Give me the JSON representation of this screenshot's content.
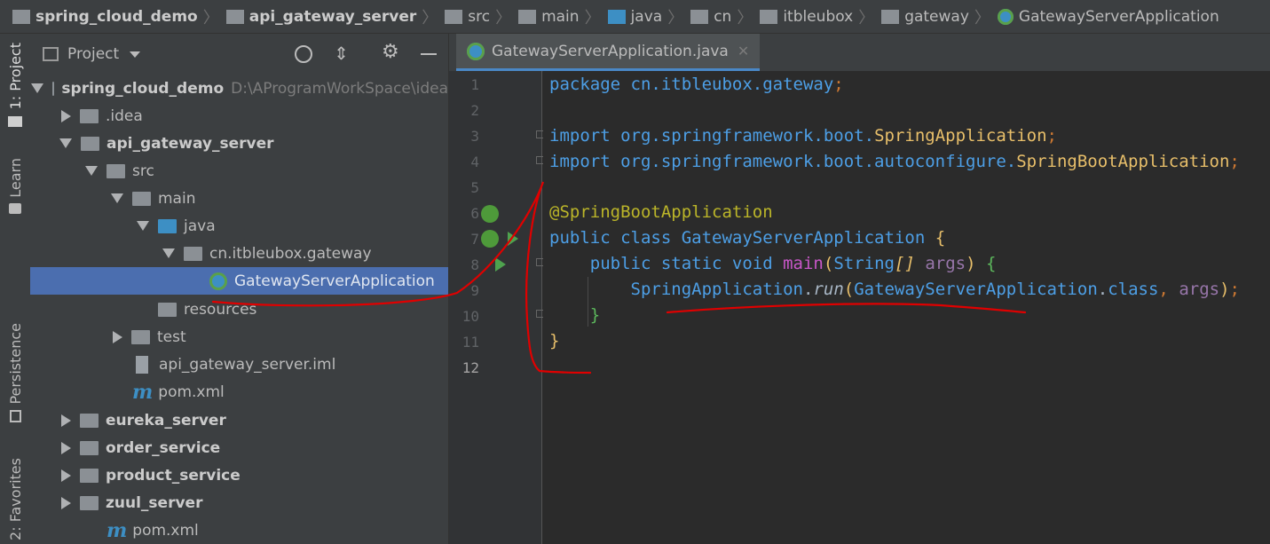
{
  "breadcrumb": [
    {
      "label": "spring_cloud_demo",
      "bold": true,
      "icon": "module-folder-icon"
    },
    {
      "label": "api_gateway_server",
      "bold": true,
      "icon": "module-folder-icon"
    },
    {
      "label": "src",
      "icon": "folder-icon"
    },
    {
      "label": "main",
      "icon": "folder-icon"
    },
    {
      "label": "java",
      "icon": "source-folder-icon"
    },
    {
      "label": "cn",
      "icon": "package-icon"
    },
    {
      "label": "itbleubox",
      "icon": "package-icon"
    },
    {
      "label": "gateway",
      "icon": "package-icon"
    },
    {
      "label": "GatewayServerApplication",
      "icon": "spring-boot-class-icon"
    }
  ],
  "toolstrip": {
    "project": "1: Project",
    "learn": "Learn",
    "persistence": "Persistence",
    "favorites": "2: Favorites"
  },
  "project_panel": {
    "title": "Project",
    "tree": [
      {
        "label": "spring_cloud_demo",
        "bold": true,
        "path": "D:\\AProgramWorkSpace\\idea",
        "expanded": true,
        "depth": 0,
        "icon": "module-folder-icon"
      },
      {
        "label": ".idea",
        "expanded": false,
        "depth": 1,
        "icon": "folder-icon"
      },
      {
        "label": "api_gateway_server",
        "bold": true,
        "expanded": true,
        "depth": 1,
        "icon": "module-folder-icon"
      },
      {
        "label": "src",
        "expanded": true,
        "depth": 2,
        "icon": "folder-icon"
      },
      {
        "label": "main",
        "expanded": true,
        "depth": 3,
        "icon": "folder-icon"
      },
      {
        "label": "java",
        "expanded": true,
        "depth": 4,
        "icon": "source-folder-icon"
      },
      {
        "label": "cn.itbleubox.gateway",
        "expanded": true,
        "depth": 5,
        "icon": "package-icon"
      },
      {
        "label": "GatewayServerApplication",
        "selected": true,
        "depth": 6,
        "icon": "spring-boot-class-icon"
      },
      {
        "label": "resources",
        "depth": 4,
        "icon": "resources-folder-icon"
      },
      {
        "label": "test",
        "expanded": false,
        "depth": 3,
        "icon": "folder-icon"
      },
      {
        "label": "api_gateway_server.iml",
        "depth": 3,
        "icon": "iml-file-icon"
      },
      {
        "label": "pom.xml",
        "depth": 3,
        "icon": "maven-icon"
      },
      {
        "label": "eureka_server",
        "bold": true,
        "expanded": false,
        "depth": 1,
        "icon": "module-folder-icon"
      },
      {
        "label": "order_service",
        "bold": true,
        "expanded": false,
        "depth": 1,
        "icon": "module-folder-icon"
      },
      {
        "label": "product_service",
        "bold": true,
        "expanded": false,
        "depth": 1,
        "icon": "module-folder-icon"
      },
      {
        "label": "zuul_server",
        "bold": true,
        "expanded": false,
        "depth": 1,
        "icon": "module-folder-icon"
      },
      {
        "label": "pom.xml",
        "depth": 2,
        "icon": "maven-icon"
      }
    ]
  },
  "editor": {
    "tab_label": "GatewayServerApplication.java",
    "line_numbers": [
      "1",
      "2",
      "3",
      "4",
      "5",
      "6",
      "7",
      "8",
      "9",
      "10",
      "11",
      "12"
    ],
    "current_line": "12"
  },
  "colors": {
    "accent": "#4b6eaf",
    "annotation": "#e00000",
    "keyword": "#cc7832"
  }
}
